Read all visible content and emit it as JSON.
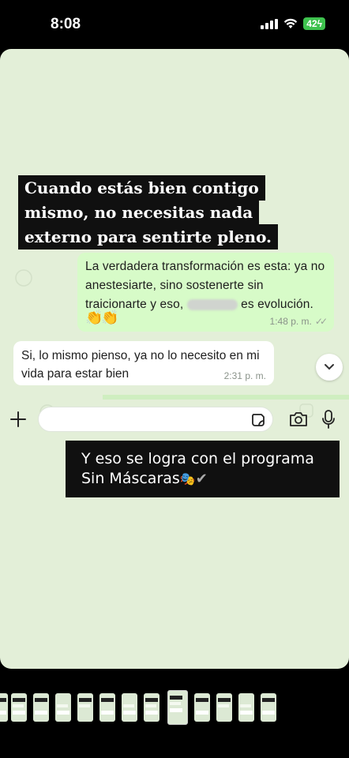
{
  "status_bar": {
    "time": "8:08",
    "battery": "42"
  },
  "story": {
    "headline_lines": [
      "Cuando estás bien contigo",
      "mismo, no necesitas nada",
      "externo para sentirte pleno."
    ],
    "outgoing_message": {
      "text_part1": "La verdadera transformación es esta: ya no anestesiarte, sino sostenerte sin traicionarte y eso,",
      "text_part2": "es evolución.",
      "time": "1:48 p. m."
    },
    "incoming_message": {
      "text": "Si, lo mismo pienso, ya no lo necesito en mi vida para estar bien",
      "time": "2:31 p. m."
    },
    "caption": {
      "line1": "Y eso se logra con el programa",
      "line2": "Sin Máscaras"
    }
  },
  "colors": {
    "chat_background": "#e3efd8",
    "outgoing_bubble": "#d7fbc8",
    "incoming_bubble": "#ffffff",
    "headline_box": "#101010",
    "battery": "#3ec24e"
  },
  "thumbnail_strip": {
    "count": 13,
    "active_index": 7
  }
}
